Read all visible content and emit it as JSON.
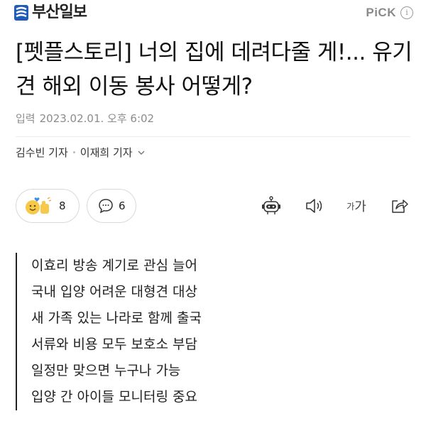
{
  "header": {
    "logo_text": "부산일보",
    "pick_label": "PiCK",
    "info_icon": "i"
  },
  "article": {
    "headline": "[펫플스토리] 너의 집에 데려다줄 게!... 유기견 해외 이동 봉사 어떻게?",
    "date_label": "입력",
    "date_value": "2023.02.01. 오후 6:02",
    "authors": [
      "김수빈 기자",
      "이재희 기자"
    ]
  },
  "actions": {
    "reaction_count": "8",
    "comment_count": "6",
    "font_tool_small": "가",
    "font_tool_large": "가"
  },
  "summary": [
    "이효리 방송 계기로 관심 늘어",
    "국내 입양 어려운 대형견 대상",
    "새 가족 있는 나라로 함께 출국",
    "서류와 비용 모두 보호소 부담",
    "일정만 맞으면 누구나 가능",
    "입양 간 아이들 모니터링 중요"
  ],
  "colors": {
    "brand_blue": "#1f5bb8",
    "muted_text": "#8c8c8c",
    "emoji_yellow": "#f7c948"
  },
  "icons": [
    "logo-mark-icon",
    "info-icon",
    "reaction-emoji-icon",
    "comment-icon",
    "robot-icon",
    "speaker-icon",
    "share-icon",
    "chevron-down-icon"
  ]
}
